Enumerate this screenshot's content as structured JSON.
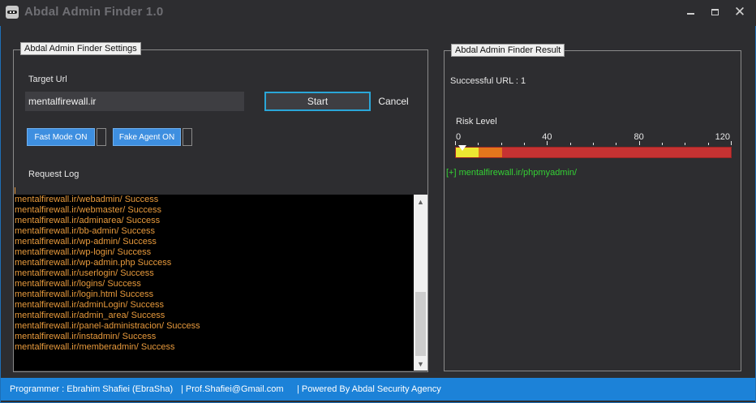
{
  "window": {
    "title": "Abdal Admin Finder 1.0",
    "close_glyph": "✕"
  },
  "settings": {
    "group_title": "Abdal Admin Finder Settings",
    "target_url_label": "Target Url",
    "target_url_value": "mentalfirewall.ir",
    "start_label": "Start",
    "cancel_label": "Cancel",
    "fast_mode_label": "Fast Mode ON",
    "fake_agent_label": "Fake Agent ON",
    "request_log_label": "Request Log"
  },
  "log": {
    "text_color": "#e89a3c",
    "entries": [
      "mentalfirewall.ir/webadmin/ Success",
      "mentalfirewall.ir/webmaster/ Success",
      "mentalfirewall.ir/adminarea/ Success",
      "mentalfirewall.ir/bb-admin/ Success",
      "mentalfirewall.ir/wp-admin/ Success",
      "mentalfirewall.ir/wp-login/ Success",
      "mentalfirewall.ir/wp-admin.php Success",
      "mentalfirewall.ir/userlogin/ Success",
      "mentalfirewall.ir/logins/ Success",
      "mentalfirewall.ir/login.html Success",
      "mentalfirewall.ir/adminLogin/ Success",
      "mentalfirewall.ir/admin_area/ Success",
      "mentalfirewall.ir/panel-administracion/ Success",
      "mentalfirewall.ir/instadmin/ Success",
      "mentalfirewall.ir/memberadmin/ Success"
    ]
  },
  "result": {
    "group_title": "Abdal Admin Finder Result",
    "successful_url_label": "Successful URL :",
    "successful_url_count": "1",
    "risk_level_label": "Risk Level",
    "risk_scale_ticks": [
      "0",
      "40",
      "80",
      "120"
    ],
    "risk_value": 1,
    "risk_colors": {
      "low": "#ece832",
      "medium": "#e3761c",
      "high": "#c63232"
    },
    "found_entry": "[+] mentalfirewall.ir/phpmyadmin/",
    "found_color": "#34d034"
  },
  "status_bar": {
    "programmer": "Programmer : Ebrahim Shafiei (EbraSha)",
    "email": "|  Prof.Shafiei@Gmail.com",
    "powered_by": "| Powered By Abdal Security Agency",
    "background": "#1c82d8"
  },
  "icons": {
    "app": "ninja-app-icon",
    "minimize": "minimize-icon",
    "maximize": "maximize-icon",
    "close": "close-icon",
    "scroll_up": "scroll-up-arrow-icon",
    "scroll_down": "scroll-down-arrow-icon"
  }
}
